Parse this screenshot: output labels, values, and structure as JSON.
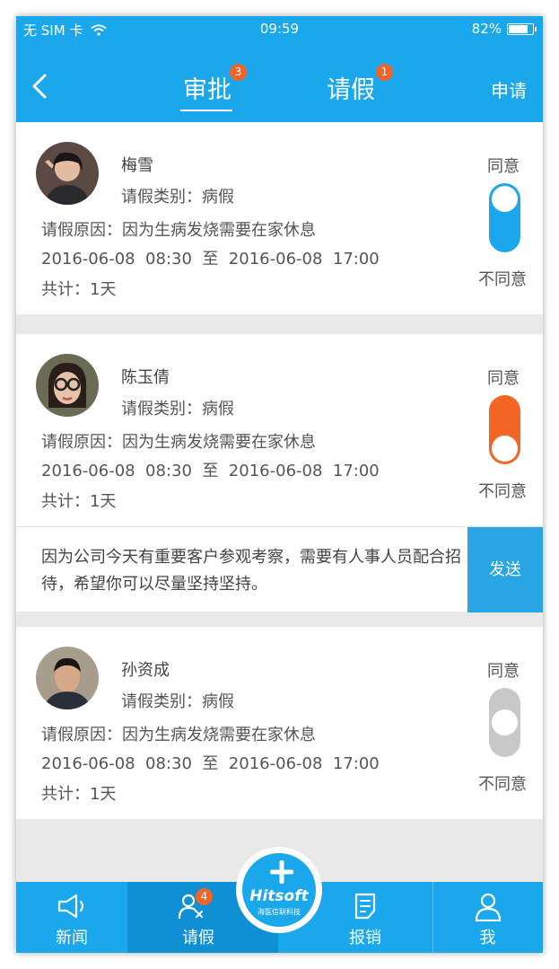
{
  "status_bar": {
    "carrier": "无 SIM 卡",
    "time": "09:59",
    "battery": "82%",
    "battery_level": 0.82
  },
  "header": {
    "tabs": [
      {
        "label": "审批",
        "badge": "3"
      },
      {
        "label": "请假",
        "badge": "1"
      }
    ],
    "apply_label": "申请"
  },
  "colors": {
    "primary": "#1aa7ec",
    "badge": "#f0642a",
    "toggle_on": "#1aa7ec",
    "toggle_off": "#f26522",
    "toggle_neutral": "#c8c8c8"
  },
  "requests": [
    {
      "name": "梅雪",
      "type": "请假类别：病假",
      "reason": "请假原因：因为生病发烧需要在家休息",
      "period": "2016-06-08  08:30  至  2016-06-08  17:00",
      "total": "共计：1天",
      "agree_label": "同意",
      "disagree_label": "不同意",
      "decision": "agree"
    },
    {
      "name": "陈玉倩",
      "type": "请假类别：病假",
      "reason": "请假原因：因为生病发烧需要在家休息",
      "period": "2016-06-08  08:30  至  2016-06-08  17:00",
      "total": "共计：1天",
      "agree_label": "同意",
      "disagree_label": "不同意",
      "decision": "disagree"
    },
    {
      "name": "孙资成",
      "type": "请假类别：病假",
      "reason": "请假原因：因为生病发烧需要在家休息",
      "period": "2016-06-08  08:30  至  2016-06-08  17:00",
      "total": "共计：1天",
      "agree_label": "同意",
      "disagree_label": "不同意",
      "decision": "pending"
    }
  ],
  "reply": {
    "text": "因为公司今天有重要客户参观考察，需要有人事人员配合招待，希望你可以尽量坚持坚持。",
    "send_label": "发送"
  },
  "bottom_nav": {
    "items": [
      {
        "label": "新闻",
        "icon": "megaphone-icon"
      },
      {
        "label": "请假",
        "icon": "user-x-icon",
        "badge": "4"
      },
      {
        "label": "报销",
        "icon": "document-edit-icon"
      },
      {
        "label": "我",
        "icon": "person-icon"
      }
    ],
    "fab": {
      "logo": "Hitsoft",
      "subtitle": "海医信联科技"
    }
  }
}
